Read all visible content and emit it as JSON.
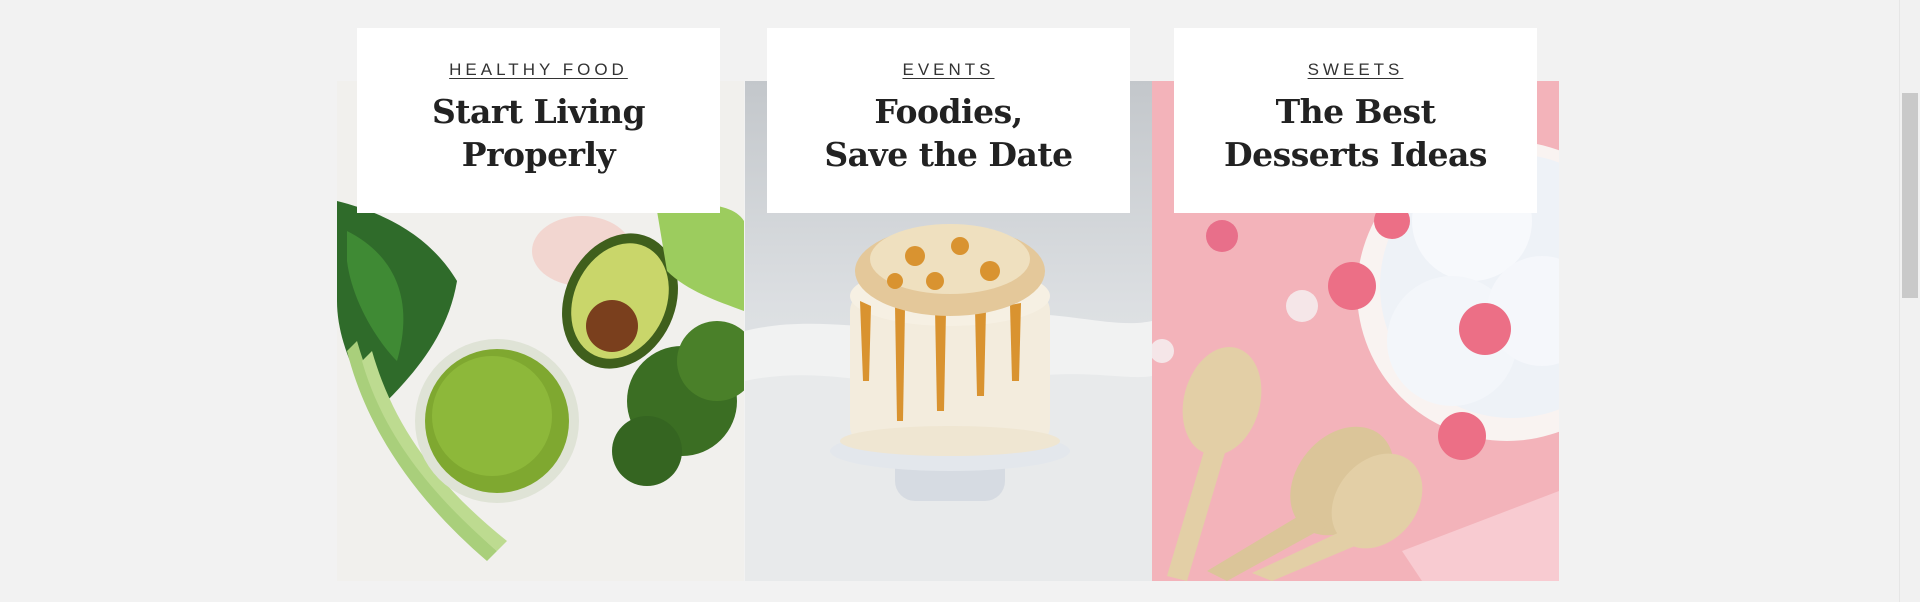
{
  "cards": [
    {
      "category": "HEALTHY FOOD",
      "title_line1": "Start Living",
      "title_line2": "Properly",
      "image": "green-smoothie-vegetables"
    },
    {
      "category": "EVENTS",
      "title_line1": "Foodies,",
      "title_line2": "Save the Date",
      "image": "caramel-popcorn-cake"
    },
    {
      "category": "SWEETS",
      "title_line1": "The Best",
      "title_line2": "Desserts Ideas",
      "image": "ice-cream-wooden-spoons"
    }
  ],
  "colors": {
    "background": "#f2f2f2",
    "caption_bg": "#ffffff",
    "text": "#222222"
  }
}
